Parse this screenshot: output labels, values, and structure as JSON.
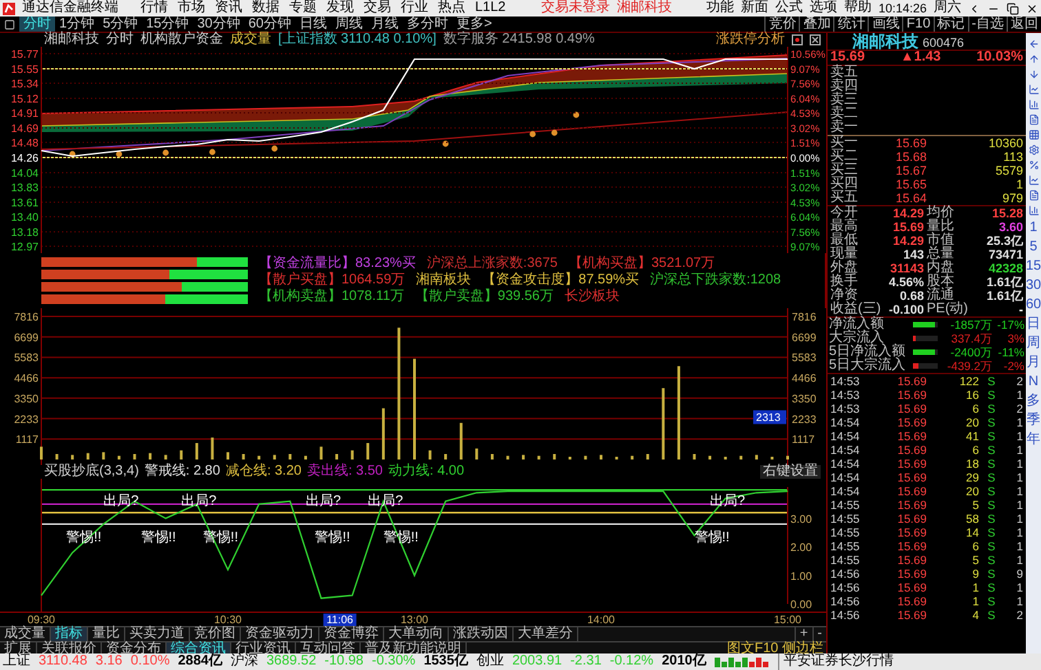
{
  "app": {
    "title": "通达信金融终端",
    "menu": [
      "行情",
      "市场",
      "资讯",
      "数据",
      "专题",
      "发现",
      "交易",
      "行业",
      "热点",
      "L1L2"
    ],
    "notices": [
      "交易未登录",
      "湘邮科技"
    ],
    "right_menu": [
      "功能",
      "新面",
      "公式",
      "选项",
      "帮助"
    ],
    "clock": "10:14:26",
    "weekday": "周六"
  },
  "period_tabs": [
    {
      "label": "分时",
      "selected": true
    },
    {
      "label": "1分钟",
      "selected": false
    },
    {
      "label": "5分钟",
      "selected": false
    },
    {
      "label": "15分钟",
      "selected": false
    },
    {
      "label": "30分钟",
      "selected": false
    },
    {
      "label": "60分钟",
      "selected": false
    },
    {
      "label": "日线",
      "selected": false
    },
    {
      "label": "周线",
      "selected": false
    },
    {
      "label": "月线",
      "selected": false
    },
    {
      "label": "多分时",
      "selected": false
    },
    {
      "label": "更多>",
      "selected": false
    }
  ],
  "chart_tools": [
    "竞价",
    "叠加",
    "统计",
    "画线",
    "F10",
    "标记",
    "-自选",
    "返回"
  ],
  "chart_header": {
    "items": [
      {
        "text": "湘邮科技",
        "color": "#d0d0d0"
      },
      {
        "text": "分时",
        "color": "#d0d0d0"
      },
      {
        "text": "机构散户资金",
        "color": "#d0d0d0"
      },
      {
        "text": "成交量",
        "color": "#e0c040"
      },
      {
        "text": "[上证指数 3110.48 0.10%]",
        "color": "#40c0c0"
      },
      {
        "text": "数字服务 2415.98 0.49%",
        "color": "#a0a0a0"
      }
    ],
    "analysis": "涨跌停分析"
  },
  "price_chart": {
    "prev_close": "14.26",
    "pct_ticks": [
      "10.56%",
      "9.07%",
      "7.56%",
      "6.04%",
      "4.53%",
      "3.02%",
      "1.51%",
      "0.00%",
      "1.51%",
      "3.02%",
      "4.53%",
      "6.04%",
      "7.56%",
      "9.07%"
    ],
    "chart_data": {
      "type": "line",
      "series": [
        {
          "color": "#ffffff",
          "values": [
            14.36,
            14.28,
            14.33,
            14.38,
            14.42,
            14.45,
            14.52,
            14.5,
            14.56,
            14.63,
            14.78,
            14.95,
            15.69,
            15.69,
            15.69,
            15.69,
            15.69,
            15.69,
            15.69,
            15.69,
            15.69,
            15.55,
            15.69,
            15.69,
            15.69
          ]
        }
      ],
      "grid": true,
      "ylim": [
        12.97,
        15.77
      ],
      "yticks": [
        15.77,
        15.55,
        15.34,
        15.12,
        14.91,
        14.69,
        14.48,
        14.26,
        14.04,
        13.83,
        13.61,
        {
          "value": 13.4,
          "label": "13.40"
        },
        13.18,
        12.97
      ]
    }
  },
  "flow_bars": [
    {
      "level": 0.75
    },
    {
      "level": 0.62
    },
    {
      "level": 0.68
    },
    {
      "level": 0.6
    }
  ],
  "info_items": [
    {
      "text": "【资金流量比】83.23%买",
      "color": "#c040e0"
    },
    {
      "text": "沪深总上涨家数:3675",
      "color": "#d03030"
    },
    {
      "text": "【机构买盘】3521.07万",
      "color": "#e03030"
    },
    {
      "text": "【散户买盘】1064.59万",
      "color": "#e03030"
    },
    {
      "text": "湘南板块",
      "color": "#e0c040"
    },
    {
      "text": "【资金攻击度】87.59%买",
      "color": "#e0c040"
    },
    {
      "text": "沪深总下跌家数:1208",
      "color": "#30c030"
    },
    {
      "text": "【机构卖盘】1078.11万",
      "color": "#30c030"
    },
    {
      "text": "【散户卖盘】939.56万",
      "color": "#30c030"
    },
    {
      "text": "长沙板块",
      "color": "#e03030"
    }
  ],
  "volume_chart": {
    "cursor": "2313",
    "right_ticks": [
      "7816",
      "6699",
      "5583",
      "4466",
      "3350",
      "2233",
      "1117"
    ],
    "chart_data": {
      "type": "bar",
      "values": [
        700,
        300,
        250,
        350,
        400,
        200,
        300,
        350,
        250,
        500,
        900,
        1200,
        400,
        300,
        200,
        250,
        300,
        200,
        700,
        300,
        500,
        900,
        2800,
        7200,
        5500,
        500,
        300,
        2000,
        600,
        300,
        200,
        250,
        200,
        300,
        150,
        200,
        250,
        150,
        200,
        300,
        3900,
        5100,
        300,
        200,
        150,
        200,
        250,
        150,
        200
      ],
      "grid": true,
      "ylim": [
        0,
        7816
      ],
      "yticks": [
        1117,
        2233,
        3350,
        4466,
        5583,
        6699,
        7816
      ]
    }
  },
  "indicator": {
    "name": "买股抄底(3,3,4)",
    "lines": [
      {
        "label": "警戒线:",
        "value": "2.80",
        "color": "#e0e0e0"
      },
      {
        "label": "减仓线:",
        "value": "3.20",
        "color": "#e0c040"
      },
      {
        "label": "卖出线:",
        "value": "3.50",
        "color": "#c020c0"
      },
      {
        "label": "动力线:",
        "value": "4.00",
        "color": "#30d030"
      }
    ],
    "settings": "右键设置",
    "warnings": [
      "警惕!!",
      "警惕!!",
      "警惕!!",
      "警惕!!",
      "警惕!!",
      "警惕!!"
    ],
    "cursor": "11:06",
    "chart_data": {
      "type": "line",
      "categories": [
        "09:30",
        null,
        null,
        null,
        null,
        null,
        "10:30",
        null,
        null,
        null,
        null,
        null,
        "13:00",
        null,
        null,
        null,
        null,
        null,
        "14:00",
        null,
        null,
        null,
        null,
        null,
        "15:00"
      ],
      "series": [
        {
          "color": "#30d030",
          "values": [
            0.3,
            1.8,
            2.8,
            3.6,
            3.0,
            3.5,
            1.2,
            3.5,
            3.6,
            0.2,
            0.3,
            3.6,
            1.0,
            3.6,
            3.9,
            3.95,
            3.95,
            3.95,
            3.95,
            3.95,
            3.95,
            2.4,
            3.7,
            3.9,
            3.95
          ]
        }
      ],
      "ylim": [
        0,
        4.1
      ],
      "yticks": [
        {
          "value": 0,
          "label": "0.00"
        },
        {
          "value": 1,
          "label": "1.00"
        },
        {
          "value": 2,
          "label": "2.00"
        },
        {
          "value": 3,
          "label": "3.00"
        }
      ],
      "annotations": [
        "出局?",
        "出局?",
        "出局?",
        "出局?",
        "出局?"
      ]
    }
  },
  "bottom_tabs": [
    {
      "label": "成交量",
      "selected": false
    },
    {
      "label": "指标",
      "selected": true
    },
    {
      "label": "量比",
      "selected": false
    },
    {
      "label": "买卖力道",
      "selected": false
    },
    {
      "label": "竞价图",
      "selected": false
    },
    {
      "label": "资金驱动力",
      "selected": false
    },
    {
      "label": "资金博弈",
      "selected": false
    },
    {
      "label": "大单动向",
      "selected": false
    },
    {
      "label": "涨跌动因",
      "selected": false
    },
    {
      "label": "大单差分",
      "selected": false
    }
  ],
  "zoom_buttons": [
    "+",
    "-"
  ],
  "extra_tabs": [
    {
      "label": "扩展",
      "selected": false
    },
    {
      "label": "关联报价",
      "selected": false
    },
    {
      "label": "资金分布",
      "selected": false
    },
    {
      "label": "综合资讯",
      "selected": true
    },
    {
      "label": "行业资讯",
      "selected": false
    },
    {
      "label": "互动问答",
      "selected": false
    },
    {
      "label": "普及新功能说明",
      "selected": false
    }
  ],
  "side_panel_button": "图文F10 侧边栏",
  "quote": {
    "name": "湘邮科技",
    "code": "600476",
    "price": "15.69",
    "change": "▲1.43",
    "change_pct": "10.03%",
    "sell": [
      {
        "label": "卖五"
      },
      {
        "label": "卖四"
      },
      {
        "label": "卖三"
      },
      {
        "label": "卖二"
      },
      {
        "label": "卖一"
      }
    ],
    "buy": [
      {
        "label": "买一",
        "price": "15.69",
        "volume": "10360"
      },
      {
        "label": "买二",
        "price": "15.68",
        "volume": "113"
      },
      {
        "label": "买三",
        "price": "15.67",
        "volume": "5579"
      },
      {
        "label": "买四",
        "price": "15.65",
        "volume": "1"
      },
      {
        "label": "买五",
        "price": "15.64",
        "volume": "979"
      }
    ],
    "stats": [
      {
        "cells": [
          {
            "label": "今开",
            "value": "14.29",
            "color": "#ff4040"
          },
          {
            "label": "均价",
            "value": "15.28",
            "color": "#ff4040"
          }
        ]
      },
      {
        "cells": [
          {
            "label": "最高",
            "value": "15.69",
            "color": "#ff4040"
          },
          {
            "label": "量比",
            "value": "3.60",
            "color": "#e040e0"
          }
        ]
      },
      {
        "cells": [
          {
            "label": "最低",
            "value": "14.29",
            "color": "#ff4040"
          },
          {
            "label": "市值",
            "value": "25.3亿",
            "color": "#e0e0e0"
          }
        ]
      },
      {
        "cells": [
          {
            "label": "现量",
            "value": "143",
            "color": "#e0e0e0"
          },
          {
            "label": "总量",
            "value": "73471",
            "color": "#e0e0e0"
          }
        ]
      },
      {
        "cells": [
          {
            "label": "外盘",
            "value": "31143",
            "color": "#ff4040"
          },
          {
            "label": "内盘",
            "value": "42328",
            "color": "#30d030"
          }
        ]
      },
      {
        "cells": [
          {
            "label": "换手",
            "value": "4.56%",
            "color": "#e0e0e0"
          },
          {
            "label": "股本",
            "value": "1.61亿",
            "color": "#e0e0e0"
          }
        ]
      },
      {
        "cells": [
          {
            "label": "净资",
            "value": "0.68",
            "color": "#e0e0e0"
          },
          {
            "label": "流通",
            "value": "1.61亿",
            "color": "#e0e0e0"
          }
        ]
      },
      {
        "cells": [
          {
            "label": "收益(三)",
            "value": "-0.100",
            "color": "#e0e0e0"
          },
          {
            "label": "PE(动)",
            "value": "-",
            "color": "#ffffff"
          }
        ]
      }
    ],
    "flows": [
      {
        "label": "净流入额",
        "level": 0.9,
        "color": "#20d020",
        "value": "-1857万",
        "pct": "-17%"
      },
      {
        "label": "大宗流入",
        "level": 0.12,
        "color": "#e02020",
        "value": "337.4万",
        "pct": "3%"
      },
      {
        "label": "5日净流入额",
        "level": 0.9,
        "color": "#20d020",
        "value": "-2400万",
        "pct": "-11%"
      },
      {
        "label": "5日大宗流入",
        "level": 0.2,
        "color": "#e02020",
        "value": "-439.2万",
        "pct": "-2%"
      }
    ],
    "ticks": [
      {
        "time": "14:53",
        "price": "15.69",
        "volume": "122",
        "side": "S",
        "count": "2"
      },
      {
        "time": "14:53",
        "price": "15.69",
        "volume": "16",
        "side": "S",
        "count": "1"
      },
      {
        "time": "14:53",
        "price": "15.69",
        "volume": "6",
        "side": "S",
        "count": "2"
      },
      {
        "time": "14:54",
        "price": "15.69",
        "volume": "20",
        "side": "S",
        "count": "1"
      },
      {
        "time": "14:54",
        "price": "15.69",
        "volume": "41",
        "side": "S",
        "count": "1"
      },
      {
        "time": "14:54",
        "price": "15.69",
        "volume": "6",
        "side": "S",
        "count": "1"
      },
      {
        "time": "14:54",
        "price": "15.69",
        "volume": "18",
        "side": "S",
        "count": "1"
      },
      {
        "time": "14:54",
        "price": "15.69",
        "volume": "29",
        "side": "S",
        "count": "1"
      },
      {
        "time": "14:54",
        "price": "15.69",
        "volume": "20",
        "side": "S",
        "count": "1"
      },
      {
        "time": "14:55",
        "price": "15.69",
        "volume": "5",
        "side": "S",
        "count": "1"
      },
      {
        "time": "14:55",
        "price": "15.69",
        "volume": "58",
        "side": "S",
        "count": "1"
      },
      {
        "time": "14:55",
        "price": "15.69",
        "volume": "14",
        "side": "S",
        "count": "1"
      },
      {
        "time": "14:55",
        "price": "15.69",
        "volume": "6",
        "side": "S",
        "count": "1"
      },
      {
        "time": "14:55",
        "price": "15.69",
        "volume": "5",
        "side": "S",
        "count": "1"
      },
      {
        "time": "14:56",
        "price": "15.69",
        "volume": "9",
        "side": "S",
        "count": "9"
      },
      {
        "time": "14:56",
        "price": "15.69",
        "volume": "1",
        "side": "S",
        "count": "1"
      },
      {
        "time": "14:56",
        "price": "15.69",
        "volume": "1",
        "side": "S",
        "count": "1"
      },
      {
        "time": "14:56",
        "price": "15.69",
        "volume": "4",
        "side": "S",
        "count": "2"
      }
    ]
  },
  "period_strip": [
    "1",
    "5",
    "15",
    "30",
    "60",
    "日",
    "周",
    "月",
    "N",
    "多",
    "季",
    "年"
  ],
  "status_bar": [
    {
      "name": "上证",
      "value": "3110.48",
      "change": "3.16",
      "pct": "0.10%",
      "amount": "2884亿",
      "color": "#ff4040"
    },
    {
      "name": "沪深",
      "value": "3689.52",
      "change": "-10.98",
      "pct": "-0.30%",
      "amount": "1535亿",
      "color": "#30d030"
    },
    {
      "name": "创业",
      "value": "2003.91",
      "change": "-2.31",
      "pct": "-0.12%",
      "amount": "2010亿",
      "color": "#30d030"
    }
  ],
  "broker": "平安证券长沙行情"
}
